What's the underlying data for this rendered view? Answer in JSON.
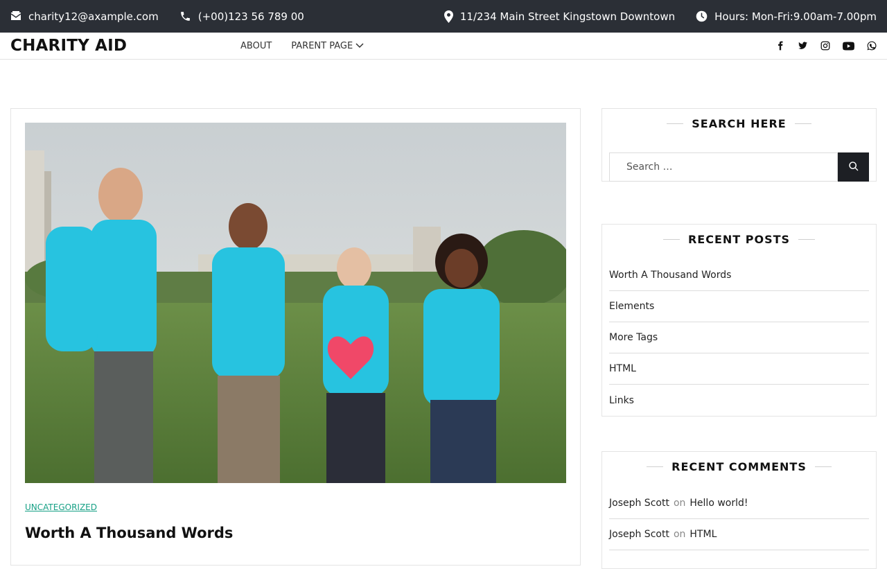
{
  "topbar": {
    "email": "charity12@axample.com",
    "phone": "(+00)123 56 789 00",
    "address": "11/234 Main Street Kingstown Downtown",
    "hours": "Hours: Mon-Fri:9.00am-7.00pm"
  },
  "header": {
    "logo": "CHARITY AID",
    "menu": [
      {
        "label": "ABOUT"
      },
      {
        "label": "PARENT PAGE",
        "has_dropdown": true
      }
    ],
    "social_icons": [
      "facebook-icon",
      "twitter-icon",
      "instagram-icon",
      "youtube-icon",
      "whatsapp-icon"
    ]
  },
  "post": {
    "category": "UNCATEGORIZED",
    "title": "Worth A Thousand Words",
    "image_description_icon": "volunteers-photo"
  },
  "sidebar": {
    "search": {
      "title": "SEARCH HERE",
      "placeholder": "Search …"
    },
    "recent_posts": {
      "title": "RECENT POSTS",
      "items": [
        "Worth A Thousand Words",
        "Elements",
        "More Tags",
        "HTML",
        "Links"
      ]
    },
    "recent_comments": {
      "title": "RECENT COMMENTS",
      "items": [
        {
          "author": "Joseph Scott",
          "on": "on",
          "post": "Hello world!"
        },
        {
          "author": "Joseph Scott",
          "on": "on",
          "post": "HTML"
        }
      ]
    }
  },
  "colors": {
    "topbar_bg": "#2b2f36",
    "accent": "#16a085",
    "search_button": "#1d1f24"
  }
}
